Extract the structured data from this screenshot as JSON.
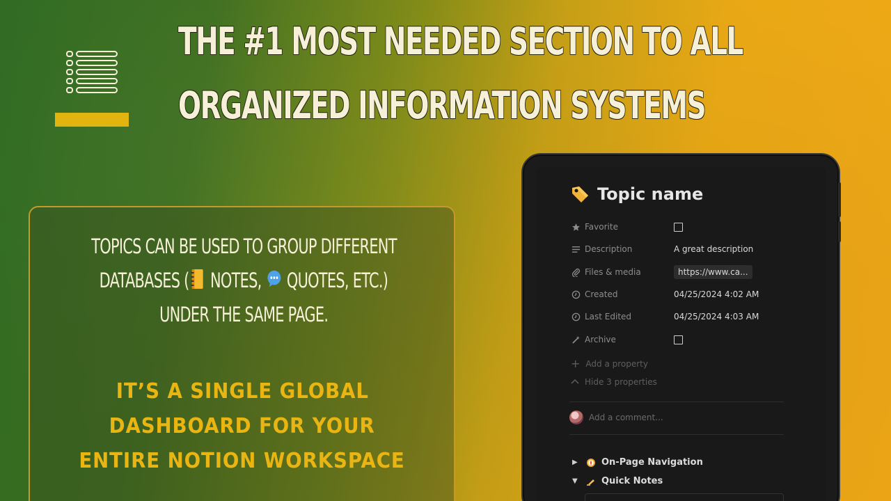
{
  "headline": {
    "line1": "THE #1 MOST NEEDED SECTION TO ALL",
    "line2": "ORGANIZED INFORMATION SYSTEMS"
  },
  "card": {
    "line1": "TOPICS CAN BE USED TO GROUP DIFFERENT",
    "line2_prefix": "DATABASES (",
    "line2_notes": "NOTES,",
    "line2_quotes": "QUOTES, ETC.)",
    "line3": "UNDER THE SAME PAGE.",
    "highlight_line1": "IT’S A SINGLE GLOBAL",
    "highlight_line2": "DASHBOARD FOR YOUR",
    "highlight_line3": "ENTIRE NOTION WORKSPACE"
  },
  "notion_page": {
    "title": "Topic name",
    "title_icon": "tag-icon",
    "properties": [
      {
        "name": "Favorite",
        "icon": "star-icon",
        "type": "checkbox",
        "checked": false
      },
      {
        "name": "Description",
        "icon": "text-lines-icon",
        "type": "text",
        "value": "A great description"
      },
      {
        "name": "Files & media",
        "icon": "paperclip-icon",
        "type": "url",
        "value": "https://www.ca..."
      },
      {
        "name": "Created",
        "icon": "clock-icon",
        "type": "date",
        "value": "04/25/2024 4:02 AM"
      },
      {
        "name": "Last Edited",
        "icon": "clock-icon",
        "type": "date",
        "value": "04/25/2024 4:03 AM"
      },
      {
        "name": "Archive",
        "icon": "magic-wand-icon",
        "type": "checkbox",
        "checked": false
      }
    ],
    "add_property": "Add a property",
    "hide_properties": "Hide 3 properties",
    "comment_placeholder": "Add a comment...",
    "toggles": [
      {
        "label": "On-Page Navigation",
        "icon": "compass-icon",
        "expanded": false
      },
      {
        "label": "Quick Notes",
        "icon": "writing-hand-icon",
        "expanded": true
      }
    ]
  },
  "colors": {
    "highlight": "#e9b512",
    "accent_bar": "#e2b40f",
    "headline_text": "#f6f0d8"
  }
}
